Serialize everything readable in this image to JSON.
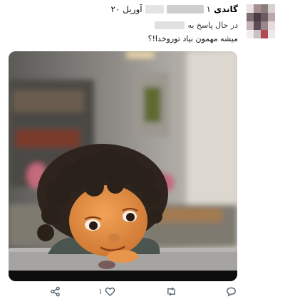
{
  "tweet": {
    "author_name": "گاندی",
    "author_name_suffix": "۱",
    "date": "۲۰ آوریل",
    "reply_prefix": "در حال پاسخ به",
    "text": "میشه مهمون نیاد توروخدا!؟"
  },
  "actions": {
    "share_icon": "share-icon",
    "like_icon": "heart-icon",
    "like_count": "۱",
    "retweet_icon": "retweet-icon",
    "reply_icon": "reply-icon"
  }
}
